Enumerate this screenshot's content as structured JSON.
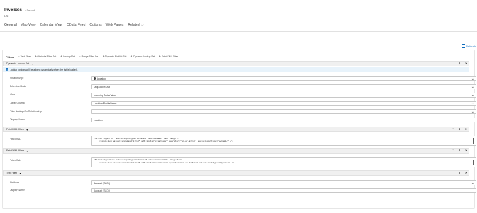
{
  "header": {
    "title": "Invoices",
    "status": "- Saved",
    "subtitle": "List",
    "tabs": [
      {
        "label": "General",
        "active": true
      },
      {
        "label": "Map View",
        "active": false
      },
      {
        "label": "Calendar View",
        "active": false
      },
      {
        "label": "OData Feed",
        "active": false
      },
      {
        "label": "Options",
        "active": false
      },
      {
        "label": "Web Pages",
        "active": false
      },
      {
        "label": "Related",
        "active": false,
        "dropdown": true
      }
    ]
  },
  "refresh_label": "Refresh",
  "filters": {
    "label": "Filters",
    "toolbar": [
      "Text Filter",
      "Attribute Filter Set",
      "Lookup Set",
      "Range Filter Set",
      "Dynamic Picklist Set",
      "Dynamic Lookup Set",
      "FetchXML Filter"
    ]
  },
  "sections": {
    "dynamic_lookup": {
      "title": "Dynamic Lookup Set",
      "info": "Lookup options will be added dynamically when the list is loaded.",
      "fields": [
        {
          "label": "Relationship",
          "value": "Location",
          "type": "select",
          "icon": "pin-icon"
        },
        {
          "label": "Selection Mode",
          "value": "Drop-down List",
          "type": "select"
        },
        {
          "label": "View",
          "value": "Incoming Portal View",
          "type": "select"
        },
        {
          "label": "Label Column",
          "value": "Location Profile Name",
          "type": "select"
        },
        {
          "label": "Filter Lookup On Relationship",
          "value": "",
          "type": "select"
        },
        {
          "label": "Display Name",
          "value": "Location",
          "type": "input"
        }
      ]
    },
    "fetchxml_1": {
      "title": "FetchXML Filter",
      "field_label": "FetchXML",
      "line1": "<filter type=\"or\" adx:uiinputtype=\"dynamic\" adx:uiname=\"Date range\">",
      "line2": "<condition value=\"standardfilter\" attribute=\"createdon\" operator=\"on-or-after\" adx:uiinputtype=\"dynamic\" />"
    },
    "fetchxml_2": {
      "title": "FetchXML Filter",
      "field_label": "FetchXML",
      "line1": "<filter type=\"or\" adx:uiinputtype=\"dynamic\" adx:uiname=\"date range/to\">",
      "line2": "<condition value=\"standardfilter\" attribute=\"createdon\" operator=\"on-or-before\" adx:uiinputtype=\"dynamic\" />"
    },
    "text_filter": {
      "title": "Text Filter",
      "fields": [
        {
          "label": "Attribute",
          "value": "Account (SLID)",
          "type": "select"
        },
        {
          "label": "Display Name",
          "value": "Account (SLID)",
          "type": "input"
        }
      ]
    }
  },
  "icons": {
    "collapse": "caret-down-icon",
    "move_up": "arrow-up-icon",
    "move_down": "arrow-down-icon",
    "delete": "close-icon",
    "add": "plus-icon",
    "refresh": "refresh-icon",
    "info": "info-icon"
  },
  "colors": {
    "accent": "#0f6cbd",
    "section_bg": "#f0f0f0",
    "info_bg": "#e8f3fb"
  }
}
